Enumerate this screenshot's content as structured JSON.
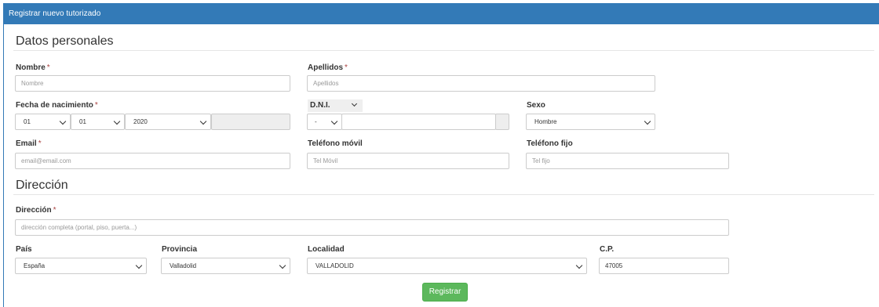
{
  "header": {
    "title": "Registrar nuevo tutorizado"
  },
  "sections": {
    "personal": "Datos personales",
    "address": "Dirección"
  },
  "required_mark": "*",
  "fields": {
    "nombre": {
      "label": "Nombre",
      "placeholder": "Nombre"
    },
    "apellidos": {
      "label": "Apellidos",
      "placeholder": "Apellidos"
    },
    "fecha": {
      "label": "Fecha de nacimiento",
      "day": "01",
      "month": "01",
      "year": "2020"
    },
    "dni": {
      "label": "D.N.I.",
      "letter": "-"
    },
    "sexo": {
      "label": "Sexo",
      "value": "Hombre"
    },
    "email": {
      "label": "Email",
      "placeholder": "email@email.com"
    },
    "tel_movil": {
      "label": "Teléfono móvil",
      "placeholder": "Tel Móvil"
    },
    "tel_fijo": {
      "label": "Teléfono fijo",
      "placeholder": "Tel fijo"
    },
    "direccion": {
      "label": "Dirección",
      "placeholder": "dirección completa (portal, piso, puerta...)"
    },
    "pais": {
      "label": "País",
      "value": "España"
    },
    "provincia": {
      "label": "Provincia",
      "value": "Valladolid"
    },
    "localidad": {
      "label": "Localidad",
      "value": "VALLADOLID"
    },
    "cp": {
      "label": "C.P.",
      "value": "47005"
    }
  },
  "submit": {
    "label": "Registrar"
  },
  "colors": {
    "primary": "#337ab7",
    "success": "#5cb85c",
    "required": "#a94442"
  }
}
